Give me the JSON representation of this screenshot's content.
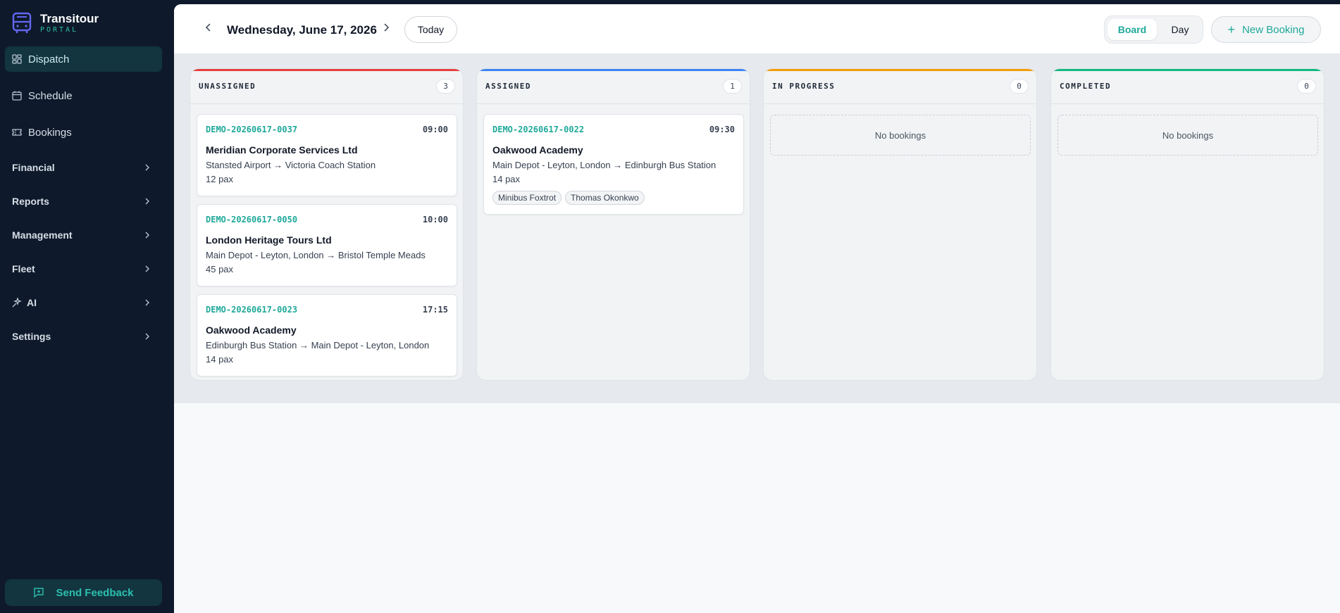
{
  "brand": {
    "title": "Transitour",
    "subtitle": "PORTAL"
  },
  "sidebar": {
    "items": [
      {
        "label": "Dispatch",
        "icon": "grid-icon",
        "active": true
      },
      {
        "label": "Schedule",
        "icon": "calendar-icon"
      },
      {
        "label": "Bookings",
        "icon": "ticket-icon"
      }
    ],
    "groups": [
      {
        "label": "Financial"
      },
      {
        "label": "Reports"
      },
      {
        "label": "Management"
      },
      {
        "label": "Fleet"
      },
      {
        "label": "AI",
        "icon": "sparkle-icon"
      },
      {
        "label": "Settings"
      }
    ],
    "feedback_label": "Send Feedback"
  },
  "header": {
    "date": "Wednesday, June 17, 2026",
    "today_label": "Today",
    "view_board": "Board",
    "view_day": "Day",
    "new_booking_label": "New Booking"
  },
  "board": {
    "columns": [
      {
        "title": "UNASSIGNED",
        "count": "3",
        "color": "#e53e3e",
        "cards": [
          {
            "ref": "DEMO-20260617-0037",
            "time": "09:00",
            "client": "Meridian Corporate Services Ltd",
            "route": "Stansted Airport → Victoria Coach Station",
            "pax": "12 pax"
          },
          {
            "ref": "DEMO-20260617-0050",
            "time": "10:00",
            "client": "London Heritage Tours Ltd",
            "route": "Main Depot - Leyton, London → Bristol Temple Meads",
            "pax": "45 pax"
          },
          {
            "ref": "DEMO-20260617-0023",
            "time": "17:15",
            "client": "Oakwood Academy",
            "route": "Edinburgh Bus Station → Main Depot - Leyton, London",
            "pax": "14 pax"
          }
        ]
      },
      {
        "title": "ASSIGNED",
        "count": "1",
        "color": "#3b82f6",
        "cards": [
          {
            "ref": "DEMO-20260617-0022",
            "time": "09:30",
            "client": "Oakwood Academy",
            "route": "Main Depot - Leyton, London → Edinburgh Bus Station",
            "pax": "14 pax",
            "vehicle": "Minibus Foxtrot",
            "driver": "Thomas Okonkwo"
          }
        ]
      },
      {
        "title": "IN PROGRESS",
        "count": "0",
        "color": "#f59e0b",
        "empty": "No bookings"
      },
      {
        "title": "COMPLETED",
        "count": "0",
        "color": "#10b981",
        "empty": "No bookings"
      }
    ]
  }
}
